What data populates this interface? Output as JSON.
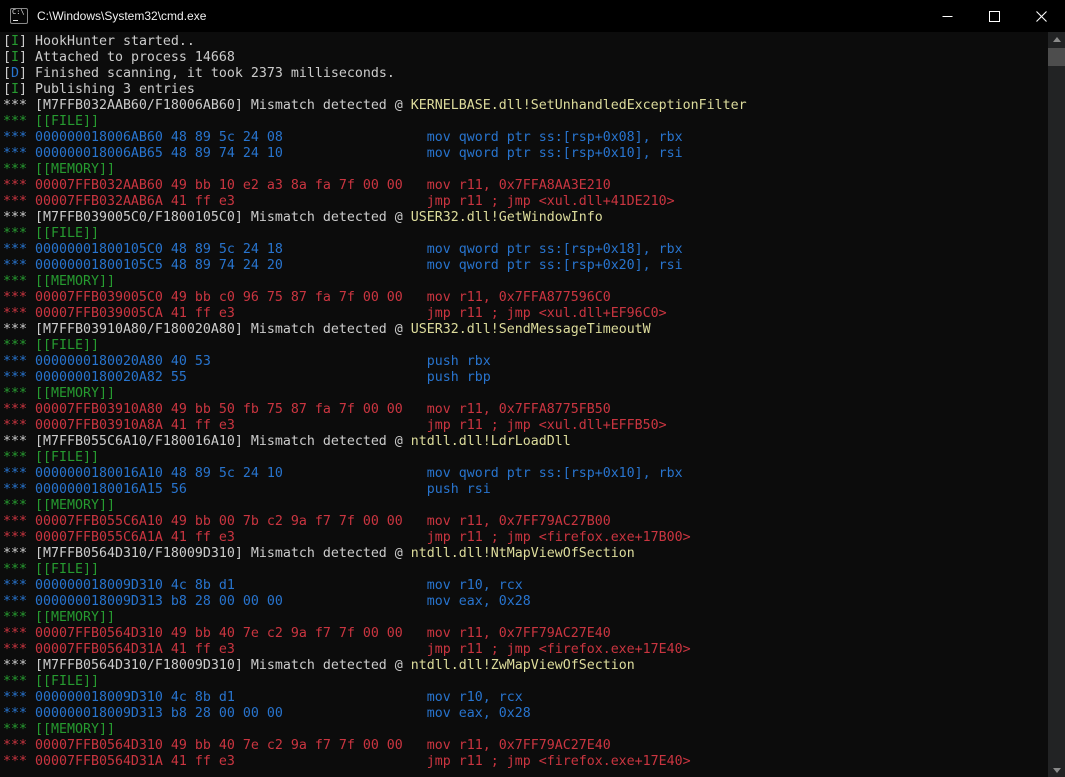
{
  "window": {
    "title": "C:\\Windows\\System32\\cmd.exe",
    "icon": "cmd-prompt-icon",
    "controls": {
      "minimize": "minimize-icon",
      "maximize": "maximize-icon",
      "close": "close-icon"
    }
  },
  "palette": {
    "console_bg": "#0C0C0C",
    "titlebar_bg": "#000000",
    "title_text": "#F0F0F0",
    "white": "#CCCCCC",
    "green": "#269B30",
    "blue": "#2874CE",
    "red": "#CA3540",
    "yellow": "#DDDC9C",
    "scrollbar_track": "#222324",
    "scrollbar_thumb": "#4D4D4D",
    "scrollbar_arrow": "#8A8A8A"
  },
  "console": {
    "lines": [
      {
        "seg": [
          {
            "t": "[",
            "c": "white"
          },
          {
            "t": "I",
            "c": "green"
          },
          {
            "t": "] HookHunter started..",
            "c": "white"
          }
        ]
      },
      {
        "seg": [
          {
            "t": "[",
            "c": "white"
          },
          {
            "t": "I",
            "c": "green"
          },
          {
            "t": "] Attached to process 14668",
            "c": "white"
          }
        ]
      },
      {
        "seg": [
          {
            "t": "[",
            "c": "white"
          },
          {
            "t": "D",
            "c": "blue"
          },
          {
            "t": "] Finished scanning, it took 2373 milliseconds.",
            "c": "white"
          }
        ]
      },
      {
        "seg": [
          {
            "t": "[",
            "c": "white"
          },
          {
            "t": "I",
            "c": "green"
          },
          {
            "t": "] Publishing 3 entries",
            "c": "white"
          }
        ]
      },
      {
        "seg": [
          {
            "t": "*** [M7FFB032AAB60/F18006AB60] Mismatch detected @ ",
            "c": "white"
          },
          {
            "t": "KERNELBASE.dll!SetUnhandledExceptionFilter",
            "c": "yellow"
          }
        ]
      },
      {
        "seg": [
          {
            "t": "*** [[FILE]]",
            "c": "green"
          }
        ]
      },
      {
        "seg": [
          {
            "t": "*** 000000018006AB60 48 89 5c 24 08",
            "c": "blue"
          },
          {
            "t": "mov qword ptr ss:[rsp+0x08], rbx",
            "c": "blue",
            "col": 53
          }
        ]
      },
      {
        "seg": [
          {
            "t": "*** 000000018006AB65 48 89 74 24 10",
            "c": "blue"
          },
          {
            "t": "mov qword ptr ss:[rsp+0x10], rsi",
            "c": "blue",
            "col": 53
          }
        ]
      },
      {
        "seg": [
          {
            "t": "*** [[MEMORY]]",
            "c": "green"
          }
        ]
      },
      {
        "seg": [
          {
            "t": "*** 00007FFB032AAB60 49 bb 10 e2 a3 8a fa 7f 00 00",
            "c": "red"
          },
          {
            "t": "mov r11, 0x7FFA8AA3E210",
            "c": "red",
            "col": 53
          }
        ]
      },
      {
        "seg": [
          {
            "t": "*** 00007FFB032AAB6A 41 ff e3",
            "c": "red"
          },
          {
            "t": "jmp r11 ; jmp <xul.dll+41DE210>",
            "c": "red",
            "col": 53
          }
        ]
      },
      {
        "seg": [
          {
            "t": "*** [M7FFB039005C0/F1800105C0] Mismatch detected @ ",
            "c": "white"
          },
          {
            "t": "USER32.dll!GetWindowInfo",
            "c": "yellow"
          }
        ]
      },
      {
        "seg": [
          {
            "t": "*** [[FILE]]",
            "c": "green"
          }
        ]
      },
      {
        "seg": [
          {
            "t": "*** 00000001800105C0 48 89 5c 24 18",
            "c": "blue"
          },
          {
            "t": "mov qword ptr ss:[rsp+0x18], rbx",
            "c": "blue",
            "col": 53
          }
        ]
      },
      {
        "seg": [
          {
            "t": "*** 00000001800105C5 48 89 74 24 20",
            "c": "blue"
          },
          {
            "t": "mov qword ptr ss:[rsp+0x20], rsi",
            "c": "blue",
            "col": 53
          }
        ]
      },
      {
        "seg": [
          {
            "t": "*** [[MEMORY]]",
            "c": "green"
          }
        ]
      },
      {
        "seg": [
          {
            "t": "*** 00007FFB039005C0 49 bb c0 96 75 87 fa 7f 00 00",
            "c": "red"
          },
          {
            "t": "mov r11, 0x7FFA877596C0",
            "c": "red",
            "col": 53
          }
        ]
      },
      {
        "seg": [
          {
            "t": "*** 00007FFB039005CA 41 ff e3",
            "c": "red"
          },
          {
            "t": "jmp r11 ; jmp <xul.dll+EF96C0>",
            "c": "red",
            "col": 53
          }
        ]
      },
      {
        "seg": [
          {
            "t": "*** [M7FFB03910A80/F180020A80] Mismatch detected @ ",
            "c": "white"
          },
          {
            "t": "USER32.dll!SendMessageTimeoutW",
            "c": "yellow"
          }
        ]
      },
      {
        "seg": [
          {
            "t": "*** [[FILE]]",
            "c": "green"
          }
        ]
      },
      {
        "seg": [
          {
            "t": "*** 0000000180020A80 40 53",
            "c": "blue"
          },
          {
            "t": "push rbx",
            "c": "blue",
            "col": 53
          }
        ]
      },
      {
        "seg": [
          {
            "t": "*** 0000000180020A82 55",
            "c": "blue"
          },
          {
            "t": "push rbp",
            "c": "blue",
            "col": 53
          }
        ]
      },
      {
        "seg": [
          {
            "t": "*** [[MEMORY]]",
            "c": "green"
          }
        ]
      },
      {
        "seg": [
          {
            "t": "*** 00007FFB03910A80 49 bb 50 fb 75 87 fa 7f 00 00",
            "c": "red"
          },
          {
            "t": "mov r11, 0x7FFA8775FB50",
            "c": "red",
            "col": 53
          }
        ]
      },
      {
        "seg": [
          {
            "t": "*** 00007FFB03910A8A 41 ff e3",
            "c": "red"
          },
          {
            "t": "jmp r11 ; jmp <xul.dll+EFFB50>",
            "c": "red",
            "col": 53
          }
        ]
      },
      {
        "seg": [
          {
            "t": "*** [M7FFB055C6A10/F180016A10] Mismatch detected @ ",
            "c": "white"
          },
          {
            "t": "ntdll.dll!LdrLoadDll",
            "c": "yellow"
          }
        ]
      },
      {
        "seg": [
          {
            "t": "*** [[FILE]]",
            "c": "green"
          }
        ]
      },
      {
        "seg": [
          {
            "t": "*** 0000000180016A10 48 89 5c 24 10",
            "c": "blue"
          },
          {
            "t": "mov qword ptr ss:[rsp+0x10], rbx",
            "c": "blue",
            "col": 53
          }
        ]
      },
      {
        "seg": [
          {
            "t": "*** 0000000180016A15 56",
            "c": "blue"
          },
          {
            "t": "push rsi",
            "c": "blue",
            "col": 53
          }
        ]
      },
      {
        "seg": [
          {
            "t": "*** [[MEMORY]]",
            "c": "green"
          }
        ]
      },
      {
        "seg": [
          {
            "t": "*** 00007FFB055C6A10 49 bb 00 7b c2 9a f7 7f 00 00",
            "c": "red"
          },
          {
            "t": "mov r11, 0x7FF79AC27B00",
            "c": "red",
            "col": 53
          }
        ]
      },
      {
        "seg": [
          {
            "t": "*** 00007FFB055C6A1A 41 ff e3",
            "c": "red"
          },
          {
            "t": "jmp r11 ; jmp <firefox.exe+17B00>",
            "c": "red",
            "col": 53
          }
        ]
      },
      {
        "seg": [
          {
            "t": "*** [M7FFB0564D310/F18009D310] Mismatch detected @ ",
            "c": "white"
          },
          {
            "t": "ntdll.dll!NtMapViewOfSection",
            "c": "yellow"
          }
        ]
      },
      {
        "seg": [
          {
            "t": "*** [[FILE]]",
            "c": "green"
          }
        ]
      },
      {
        "seg": [
          {
            "t": "*** 000000018009D310 4c 8b d1",
            "c": "blue"
          },
          {
            "t": "mov r10, rcx",
            "c": "blue",
            "col": 53
          }
        ]
      },
      {
        "seg": [
          {
            "t": "*** 000000018009D313 b8 28 00 00 00",
            "c": "blue"
          },
          {
            "t": "mov eax, 0x28",
            "c": "blue",
            "col": 53
          }
        ]
      },
      {
        "seg": [
          {
            "t": "*** [[MEMORY]]",
            "c": "green"
          }
        ]
      },
      {
        "seg": [
          {
            "t": "*** 00007FFB0564D310 49 bb 40 7e c2 9a f7 7f 00 00",
            "c": "red"
          },
          {
            "t": "mov r11, 0x7FF79AC27E40",
            "c": "red",
            "col": 53
          }
        ]
      },
      {
        "seg": [
          {
            "t": "*** 00007FFB0564D31A 41 ff e3",
            "c": "red"
          },
          {
            "t": "jmp r11 ; jmp <firefox.exe+17E40>",
            "c": "red",
            "col": 53
          }
        ]
      },
      {
        "seg": [
          {
            "t": "*** [M7FFB0564D310/F18009D310] Mismatch detected @ ",
            "c": "white"
          },
          {
            "t": "ntdll.dll!ZwMapViewOfSection",
            "c": "yellow"
          }
        ]
      },
      {
        "seg": [
          {
            "t": "*** [[FILE]]",
            "c": "green"
          }
        ]
      },
      {
        "seg": [
          {
            "t": "*** 000000018009D310 4c 8b d1",
            "c": "blue"
          },
          {
            "t": "mov r10, rcx",
            "c": "blue",
            "col": 53
          }
        ]
      },
      {
        "seg": [
          {
            "t": "*** 000000018009D313 b8 28 00 00 00",
            "c": "blue"
          },
          {
            "t": "mov eax, 0x28",
            "c": "blue",
            "col": 53
          }
        ]
      },
      {
        "seg": [
          {
            "t": "*** [[MEMORY]]",
            "c": "green"
          }
        ]
      },
      {
        "seg": [
          {
            "t": "*** 00007FFB0564D310 49 bb 40 7e c2 9a f7 7f 00 00",
            "c": "red"
          },
          {
            "t": "mov r11, 0x7FF79AC27E40",
            "c": "red",
            "col": 53
          }
        ]
      },
      {
        "seg": [
          {
            "t": "*** 00007FFB0564D31A 41 ff e3",
            "c": "red"
          },
          {
            "t": "jmp r11 ; jmp <firefox.exe+17E40>",
            "c": "red",
            "col": 53
          }
        ]
      }
    ]
  }
}
